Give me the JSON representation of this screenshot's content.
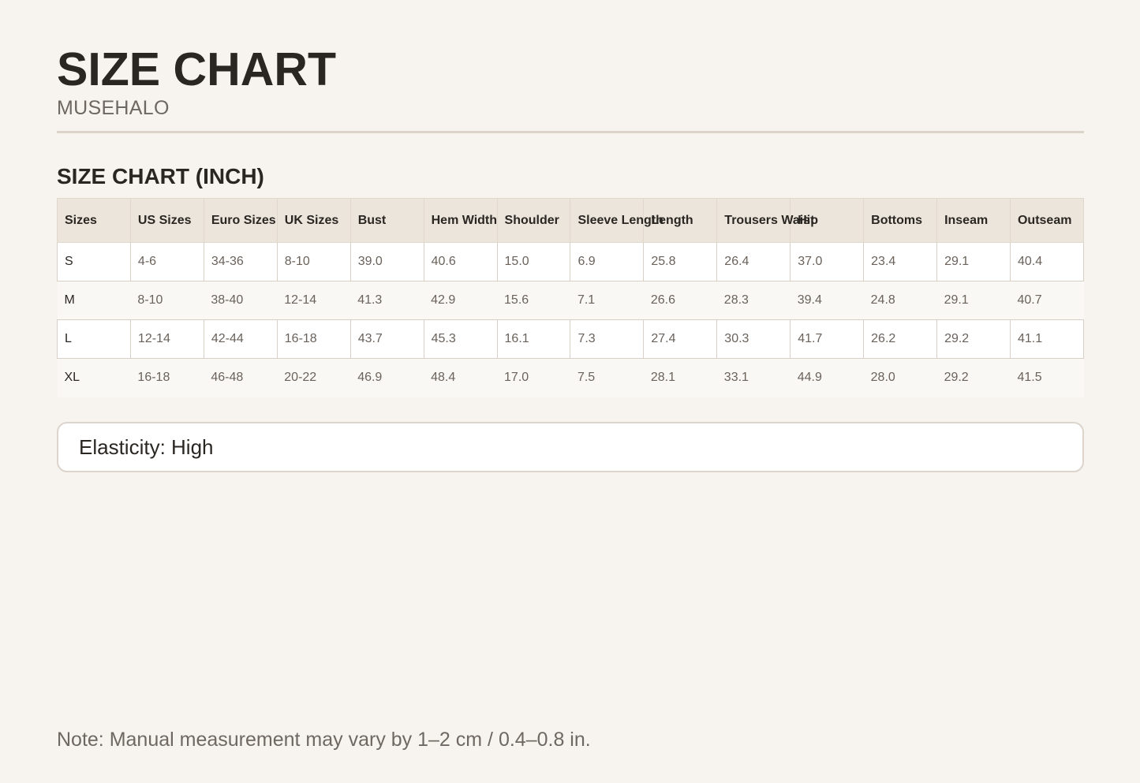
{
  "header": {
    "title": "SIZE CHART",
    "brand": "MUSEHALO"
  },
  "section": {
    "title": "SIZE CHART (INCH)"
  },
  "table": {
    "columns": [
      "Sizes",
      "US Sizes",
      "Euro Sizes",
      "UK Sizes",
      "Bust",
      "Hem Width",
      "Shoulder",
      "Sleeve Length",
      "Length",
      "Trousers Waist",
      "Hip",
      "Bottoms",
      "Inseam",
      "Outseam"
    ],
    "rows": [
      [
        "S",
        "4-6",
        "34-36",
        "8-10",
        "39.0",
        "40.6",
        "15.0",
        "6.9",
        "25.8",
        "26.4",
        "37.0",
        "23.4",
        "29.1",
        "40.4"
      ],
      [
        "M",
        "8-10",
        "38-40",
        "12-14",
        "41.3",
        "42.9",
        "15.6",
        "7.1",
        "26.6",
        "28.3",
        "39.4",
        "24.8",
        "29.1",
        "40.7"
      ],
      [
        "L",
        "12-14",
        "42-44",
        "16-18",
        "43.7",
        "45.3",
        "16.1",
        "7.3",
        "27.4",
        "30.3",
        "41.7",
        "26.2",
        "29.2",
        "41.1"
      ],
      [
        "XL",
        "16-18",
        "46-48",
        "20-22",
        "46.9",
        "48.4",
        "17.0",
        "7.5",
        "28.1",
        "33.1",
        "44.9",
        "28.0",
        "29.2",
        "41.5"
      ]
    ]
  },
  "elasticity": {
    "text": "Elasticity: High"
  },
  "footer": {
    "note": "Note: Manual measurement may vary by 1–2 cm / 0.4–0.8 in."
  }
}
